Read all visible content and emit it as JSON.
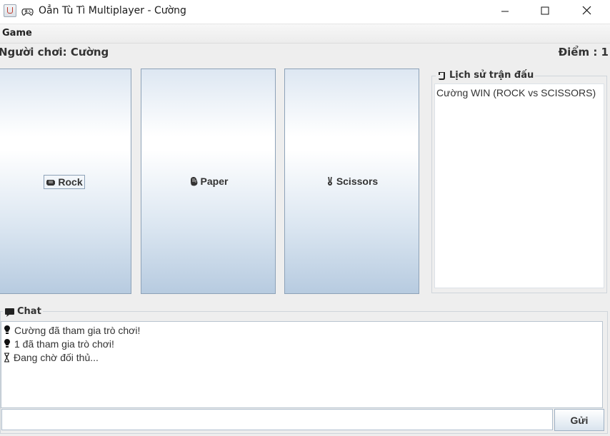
{
  "window": {
    "title": "Oẳn Tù Tì Multiplayer - Cường",
    "controls": {
      "minimize_icon": "minimize-icon",
      "maximize_icon": "maximize-icon",
      "close_icon": "close-icon"
    }
  },
  "menu": {
    "items": [
      "Game"
    ]
  },
  "status": {
    "player": "Người chơi: Cường",
    "score": "Điểm : 1"
  },
  "choices": [
    {
      "label": "Rock",
      "icon": "rock-icon"
    },
    {
      "label": "Paper",
      "icon": "paper-hand-icon"
    },
    {
      "label": "Scissors",
      "icon": "scissors-icon"
    }
  ],
  "history": {
    "title": "Lịch sử trận đấu",
    "icon": "scroll-icon",
    "entries": [
      "Cường WIN (ROCK vs SCISSORS)"
    ]
  },
  "chat": {
    "title": "Chat",
    "icon": "speech-bubble-icon",
    "messages": [
      {
        "icon": "lightbulb-icon",
        "text": "Cường đã tham gia trò chơi!"
      },
      {
        "icon": "lightbulb-icon",
        "text": "1 đã tham gia trò chơi!"
      },
      {
        "icon": "hourglass-icon",
        "text": "Đang chờ đối thủ..."
      }
    ],
    "input_value": "",
    "send_label": "Gửi"
  }
}
